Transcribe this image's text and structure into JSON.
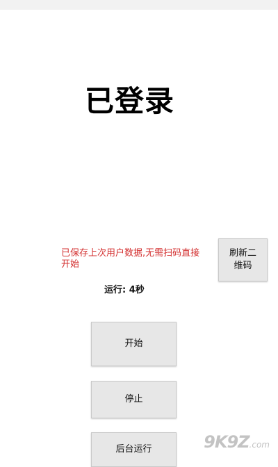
{
  "header": {
    "status_text": "已登录"
  },
  "notice": {
    "saved_user_data": "已保存上次用户数据,无需扫码直接开始"
  },
  "buttons": {
    "refresh_qr": "刷新二\n维码",
    "start": "开始",
    "stop": "停止",
    "background_run": "后台运行"
  },
  "runtime": {
    "label": "运行:",
    "value": "4秒"
  },
  "watermark": {
    "brand": "9K9Z",
    "suffix": ".com"
  }
}
